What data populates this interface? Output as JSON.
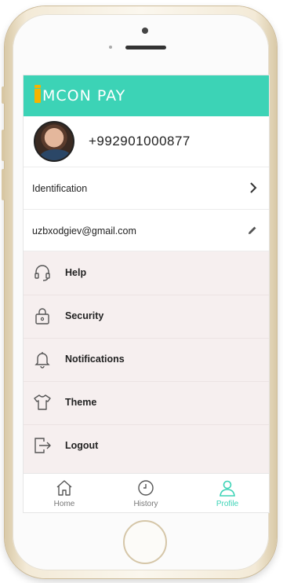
{
  "header": {
    "brand": "MCON PAY"
  },
  "profile": {
    "phone": "+992901000877"
  },
  "identification": {
    "label": "Identification"
  },
  "email": {
    "value": "uzbxodgiev@gmail.com"
  },
  "menu": {
    "items": [
      {
        "label": "Help",
        "icon": "headset-icon"
      },
      {
        "label": "Security",
        "icon": "lock-icon"
      },
      {
        "label": "Notifications",
        "icon": "bell-icon"
      },
      {
        "label": "Theme",
        "icon": "tshirt-icon"
      },
      {
        "label": "Logout",
        "icon": "logout-icon"
      }
    ]
  },
  "tabs": [
    {
      "label": "Home",
      "icon": "home-icon",
      "active": false
    },
    {
      "label": "History",
      "icon": "clock-icon",
      "active": false
    },
    {
      "label": "Profile",
      "icon": "user-icon",
      "active": true
    }
  ],
  "colors": {
    "accent": "#3cd3b6",
    "logo": "#f5b400",
    "menu_bg": "#f6efef",
    "tab_active": "#3cd3b6",
    "tab_inactive": "#777777"
  }
}
